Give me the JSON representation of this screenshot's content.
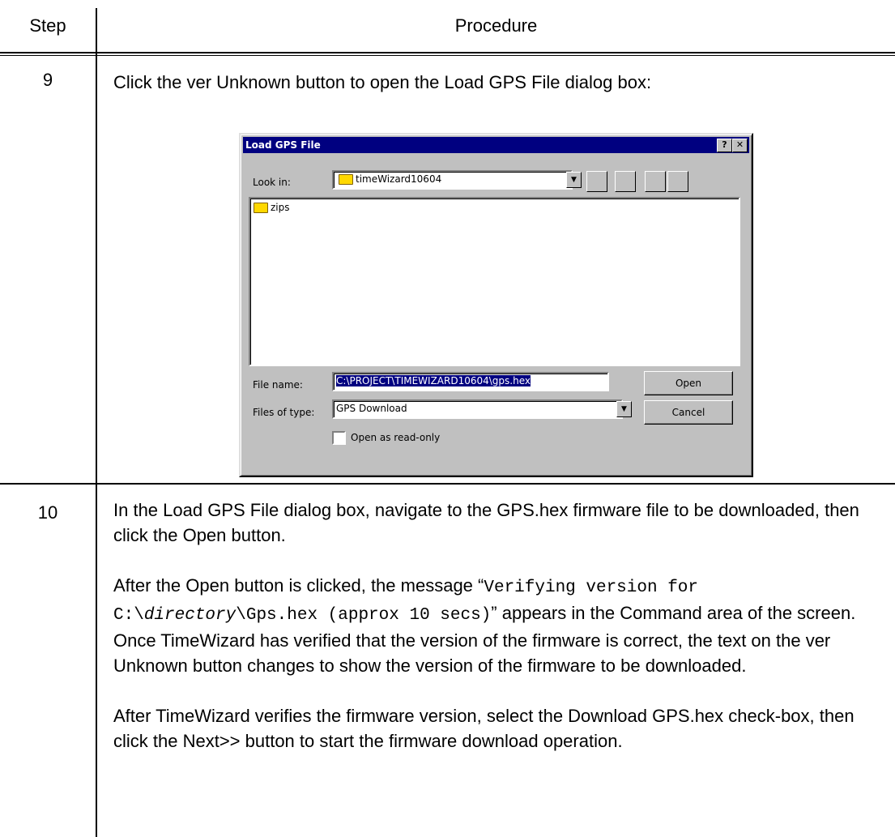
{
  "table": {
    "headers": {
      "step": "Step",
      "procedure": "Procedure"
    },
    "rows": [
      {
        "step": "9",
        "text": "Click the ver Unknown button to open the Load GPS File dialog box:"
      },
      {
        "step": "10",
        "p1": "In the Load GPS File dialog box, navigate to the GPS.hex firmware file to be downloaded, then click the Open button.",
        "p2_a": "After the Open button is clicked, the message “",
        "p2_mono1": "Verifying version for C:\\",
        "p2_dir": "directory",
        "p2_mono2": "\\Gps.hex (approx 10 secs)",
        "p2_b": "” appears in the Command area of the screen. Once TimeWizard has verified that the version of the firmware is correct, the text on the ver Unknown button changes to show the version of the firmware to be downloaded.",
        "p3": "After TimeWizard verifies the firmware version, select the Download GPS.hex check-box, then click the Next>> button to start the firmware download operation."
      }
    ]
  },
  "dialog": {
    "title": "Load GPS File",
    "help_btn": "?",
    "close_btn": "✕",
    "look_in_label": "Look in:",
    "look_in_value": "timeWizard10604",
    "items": [
      "zips"
    ],
    "file_name_label": "File name:",
    "file_name_value": "C:\\PROJECT\\TIMEWIZARD10604\\gps.hex",
    "files_of_type_label": "Files of type:",
    "files_of_type_value": "GPS Download",
    "open_btn": "Open",
    "cancel_btn": "Cancel",
    "readonly_label": "Open as read-only",
    "readonly_checked": false
  }
}
